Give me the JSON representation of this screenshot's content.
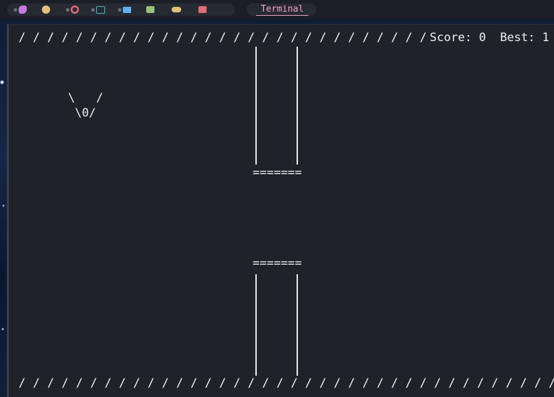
{
  "taskbar": {
    "apps": [
      {
        "icon": "game-controller-icon",
        "color": "#c678dd"
      },
      {
        "icon": "firefox-icon",
        "color": "#e5c07b"
      },
      {
        "icon": "chrome-icon",
        "color": "#e06c75"
      },
      {
        "icon": "terminal-icon",
        "color": "#56b6c2"
      },
      {
        "icon": "mail-icon",
        "color": "#61afef"
      },
      {
        "icon": "folder-icon",
        "color": "#98c379"
      },
      {
        "icon": "gamepad-icon",
        "color": "#e5c07b"
      },
      {
        "icon": "video-icon",
        "color": "#e06c75"
      }
    ],
    "active_window": "Terminal"
  },
  "game": {
    "top_border": "/ / / / / / / / / / / / / / / / / / / / / / / / / / / / / / / / / / / /",
    "bottom_border": "/ / / / / / / / / / / / / / / / / / / / / / / / / / / / / / / / / / / / / / /",
    "score_label": "Score: 0  Best: 1",
    "bird_wings": "\\   /",
    "bird_body": "\\0/",
    "pipe_cap": "======="
  }
}
